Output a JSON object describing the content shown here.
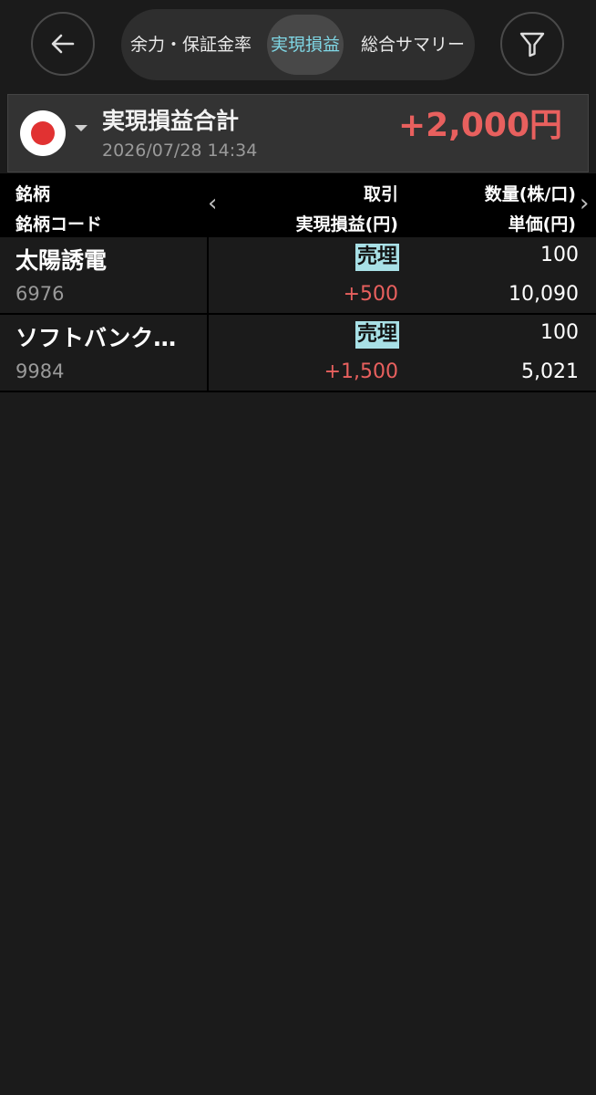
{
  "nav": {
    "back_icon": "arrow-left-icon",
    "filter_icon": "filter-icon",
    "tabs": [
      {
        "label": "余力・保証金率",
        "active": false
      },
      {
        "label": "実現損益",
        "active": true
      },
      {
        "label": "総合サマリー",
        "active": false
      }
    ]
  },
  "summary": {
    "market_icon": "japan-flag-icon",
    "title": "実現損益合計",
    "datetime": "2026/07/28 14:34",
    "total": "+2,000円"
  },
  "table": {
    "headers": {
      "name": "銘柄",
      "code": "銘柄コード",
      "trade": "取引",
      "pnl": "実現損益(円)",
      "qty": "数量(株/口)",
      "price": "単価(円)"
    },
    "rows": [
      {
        "name": "太陽誘電",
        "code": "6976",
        "trade": "売埋",
        "pnl": "+500",
        "qty": "100",
        "price": "10,090"
      },
      {
        "name": "ソフトバンク…",
        "code": "9984",
        "trade": "売埋",
        "pnl": "+1,500",
        "qty": "100",
        "price": "5,021"
      }
    ]
  },
  "colors": {
    "accent": "#7fd6e4",
    "profit": "#e8605e",
    "badge": "#a8e0e6"
  }
}
